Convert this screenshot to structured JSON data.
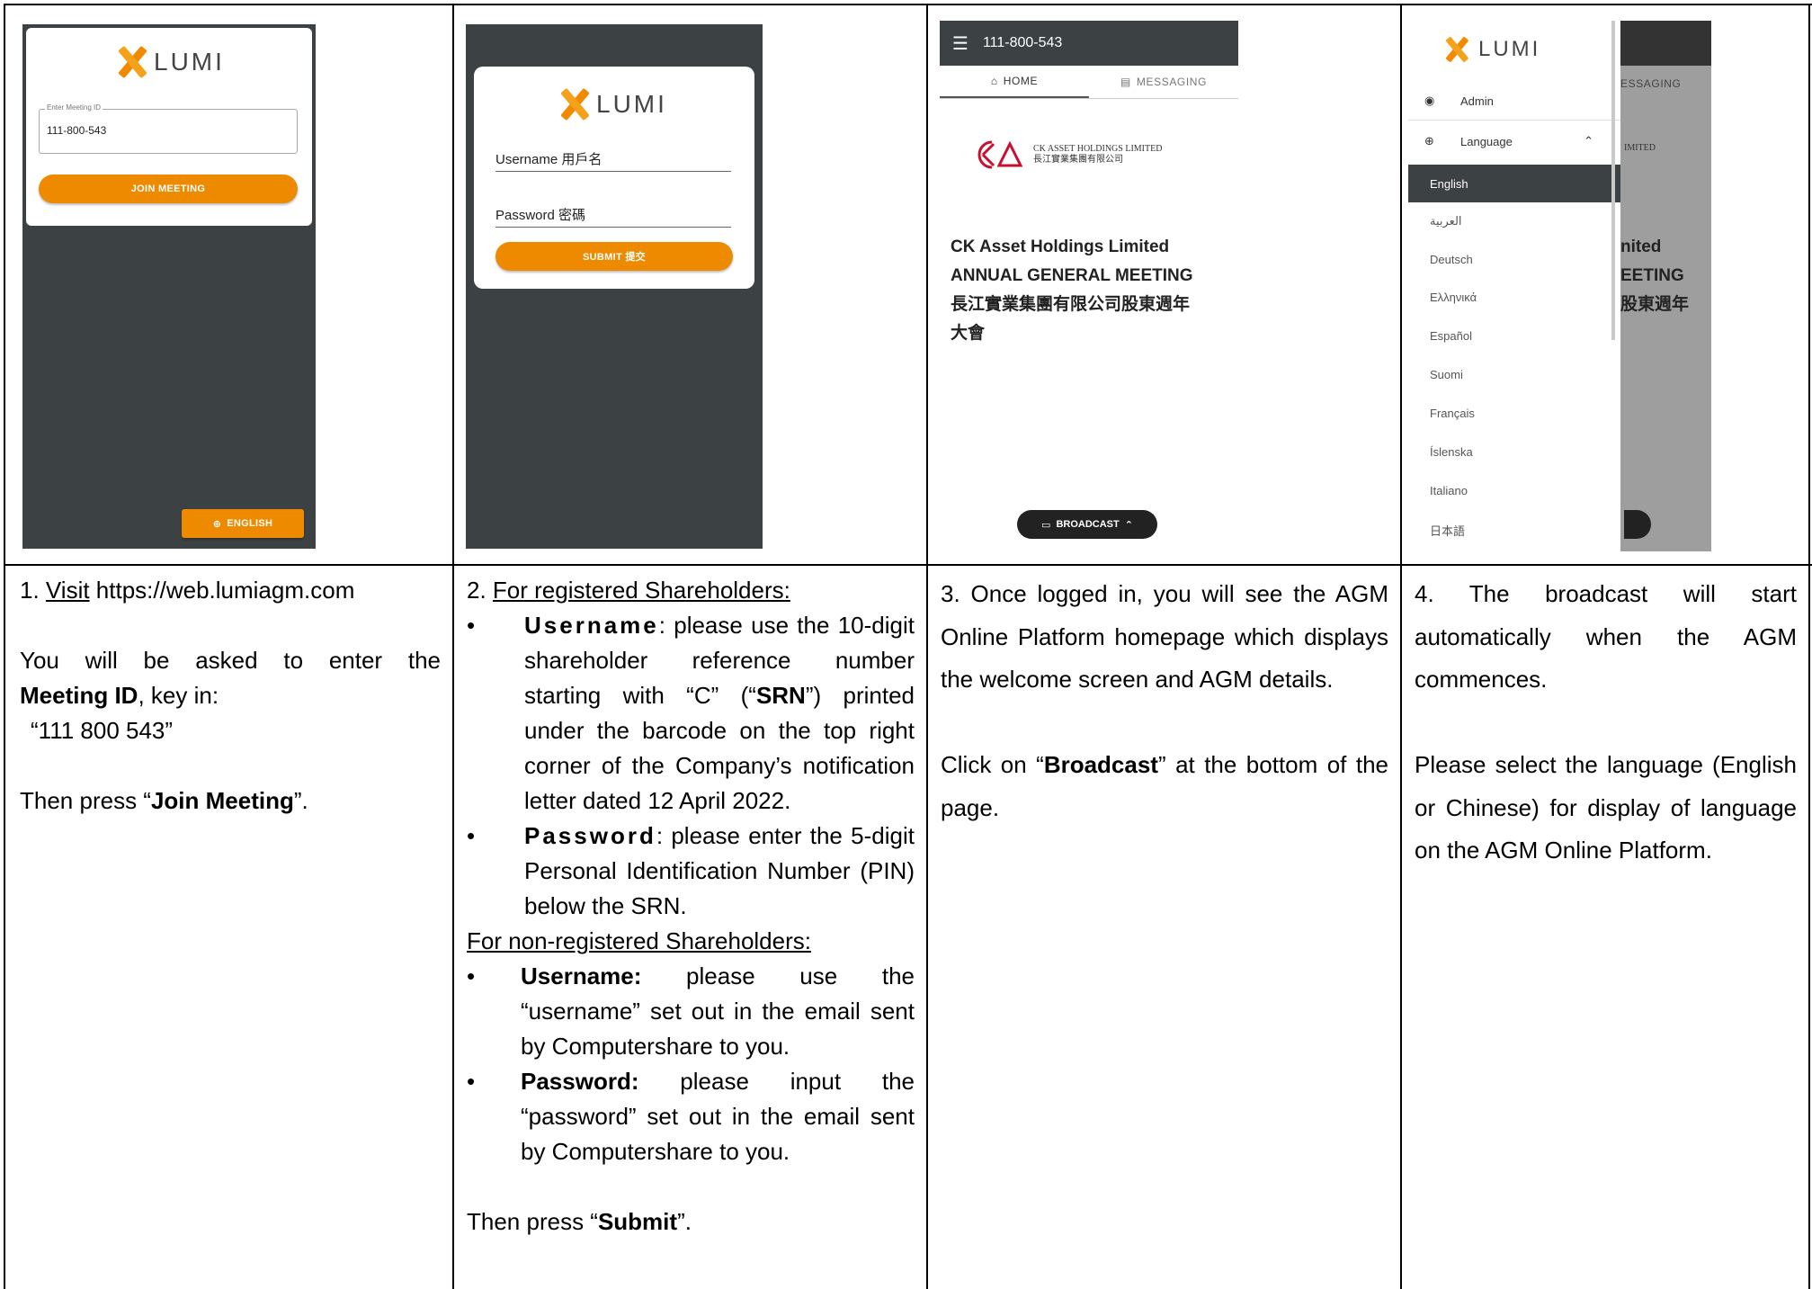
{
  "screens": {
    "s1": {
      "brand": "LUMI",
      "meeting_id_label": "Enter Meeting ID",
      "meeting_id_value": "111-800-543",
      "join_button": "JOIN MEETING",
      "language_button": "ENGLISH"
    },
    "s2": {
      "brand": "LUMI",
      "username_label": "Username 用戶名",
      "password_label": "Password 密碼",
      "submit_button": "SUBMIT 提交"
    },
    "s3": {
      "meeting_id": "111-800-543",
      "tab_home": "HOME",
      "tab_messaging": "MESSAGING",
      "company_logo_en": "CK ASSET HOLDINGS LIMITED",
      "company_logo_zh": "長江實業集團有限公司",
      "title_line1": "CK Asset Holdings Limited",
      "title_line2": "ANNUAL GENERAL MEETING",
      "title_line3": "長江實業集團有限公司股東週年",
      "title_line4": "大會",
      "broadcast_button": "BROADCAST"
    },
    "s4": {
      "brand": "LUMI",
      "menu_admin": "Admin",
      "menu_language": "Language",
      "languages": [
        "English",
        "العربية",
        "Deutsch",
        "Ελληνικά",
        "Español",
        "Suomi",
        "Français",
        "Íslenska",
        "Italiano",
        "日本語"
      ],
      "bg_tab": "ESSAGING",
      "bg_logo": "IMITED",
      "bg_title1": "nited",
      "bg_title2": "EETING",
      "bg_title3": "股東週年"
    }
  },
  "col1": {
    "step_no": "1.",
    "visit": "Visit",
    "url": " https://web.lumiagm.com",
    "asked_1": "You will be asked to enter the",
    "meeting_id": "Meeting ID",
    "key_in": ", key in:",
    "code": "“111 800 543”",
    "then_press": "Then press “",
    "join_meeting": "Join Meeting",
    "end_quote": "”."
  },
  "col2": {
    "step_no": "2.",
    "registered_heading": "For registered Shareholders:",
    "b1_label": "Username",
    "b1_text_a": ": please use the 10-digit shareholder reference number starting with “C” (“",
    "b1_srn": "SRN",
    "b1_text_b": "”) printed under the barcode on the top right corner of the Company’s notification letter dated 12 April 2022.",
    "b2_label": "Password",
    "b2_text": ": please enter the 5-digit Personal Identification Number (PIN) below the SRN.",
    "nonreg_heading": "For non-registered Shareholders:",
    "b3_label": "Username:",
    "b3_text": " please use the “username” set out in the email sent by Computershare to you.",
    "b4_label": "Password:",
    "b4_text": " please input the “password” set out in the email sent by Computershare to you.",
    "then_press": "Then press “",
    "submit": "Submit",
    "end_quote": "”."
  },
  "col3": {
    "text1": "3. Once logged in, you will see the AGM Online Platform homepage which displays the welcome screen and AGM details.",
    "click_on": "Click on “",
    "broadcast": "Broadcast",
    "text2": "” at the bottom of the page."
  },
  "col4": {
    "text1": "4. The broadcast will start automatically when the AGM commences.",
    "text2": "Please select the language (English or Chinese) for display of language on the AGM Online Platform."
  }
}
